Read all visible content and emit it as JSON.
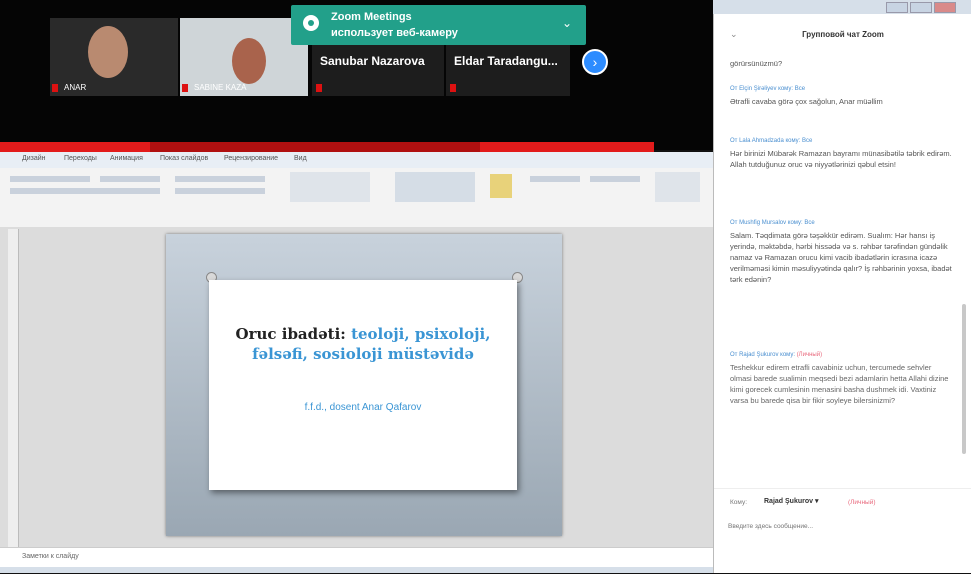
{
  "zoom_toast": {
    "title": "Zoom Meetings",
    "subtitle": "использует веб-камеру"
  },
  "participants": [
    {
      "name": "ANAR"
    },
    {
      "name": "SABINE KAZA"
    },
    {
      "name": "Sanubar Nazarova"
    },
    {
      "name": "Eldar Taradangu..."
    }
  ],
  "ribbon": {
    "tabs": [
      "Дизайн",
      "Переходы",
      "Анимация",
      "Показ слайдов",
      "Рецензирование",
      "Вид"
    ]
  },
  "slide": {
    "title_dark": "Oruc ibadəti: ",
    "title_blue": "teoloji, psixoloji, fəlsəfi, sosioloji müstəvidə",
    "author": "f.f.d., dosent Anar Qafarov"
  },
  "notes": {
    "placeholder": "Заметки к слайду"
  },
  "chat": {
    "title": "Групповой чат Zoom",
    "messages": [
      {
        "from": "",
        "to": "",
        "text": "görürsünüzmü?"
      },
      {
        "from": "Elçin Şirəliyev",
        "to": "Все",
        "text": "Ətrafli cavaba görə çox sağolun, Anar müəllim"
      },
      {
        "from": "Lala Ahmadzada",
        "to": "Все",
        "text": "Hər birinizi Mübarək Ramazan bayramı münasibətilə təbrik edirəm. Allah tutduğunuz oruc və niyyətlərinizi qəbul etsin!"
      },
      {
        "from": "Mushfig Mursalov",
        "to": "Все",
        "text": "Salam. Təqdimata görə təşəkkür edirəm. Sualım: Hər hansı iş yerində, məktəbdə, hərbi hissədə və s. rəhbər tərəfindən gündəlik namaz və Ramazan orucu kimi vacib ibadətlərin icrasına icazə verilməməsi kimin məsuliyyətində qalır? İş rəhbərinin yoxsa, ibadət tərk edənin?"
      },
      {
        "from": "Rajad Şukurov",
        "to": "(Личный)",
        "text": "Teshekkur edirem etrafli cavabiniz uchun, tercumede sehvler olmasi barede sualimin meqsedi bezi adamlarin hetta Allahi dizine kimi gorecek cumlesinin menasini basha dushmek idi. Vaxtiniz varsa bu barede qisa bir fikir soyleye bilersinizmi?"
      }
    ],
    "to_label": "Кому:",
    "to_value": "Rajad Şukurov ▾",
    "private_label": "(Личный)",
    "input_placeholder": "Введите здесь сообщение..."
  },
  "colors": {
    "zoom_green": "#22a08a",
    "zoom_blue": "#2d8cff",
    "accent_red": "#e21b1b",
    "slide_blue": "#3a95d4"
  }
}
